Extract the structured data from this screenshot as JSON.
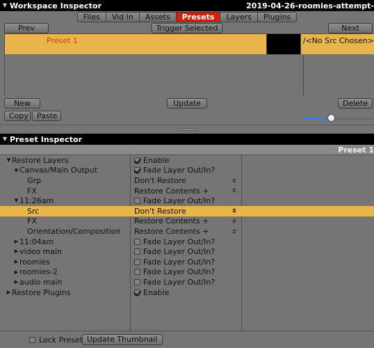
{
  "workspace_panel": {
    "title": "Workspace Inspector",
    "file_title": "2019-04-26-roomies-attempt-",
    "twisty": "▼",
    "tabs": [
      {
        "label": "Files",
        "active": false
      },
      {
        "label": "Vid In",
        "active": false
      },
      {
        "label": "Assets",
        "active": false
      },
      {
        "label": "Presets",
        "active": true
      },
      {
        "label": "Layers",
        "active": false
      },
      {
        "label": "Plugins",
        "active": false
      }
    ],
    "toolbar": {
      "prev_label": "Prev",
      "trigger_label": "Trigger Selected",
      "next_label": "Next"
    },
    "preset_rows": [
      {
        "name": "Preset 1",
        "src": "/<No Src Chosen>",
        "selected": true
      }
    ],
    "footer": {
      "new_label": "New",
      "update_label": "Update",
      "delete_label": "Delete",
      "copy_label": "Copy",
      "paste_label": "Paste",
      "slider_value": 38,
      "slider_min": 0,
      "slider_max": 100,
      "slider_fill_color": "#3b7ddd"
    }
  },
  "inspector_panel": {
    "title": "Preset Inspector",
    "twisty": "▼",
    "subbar_label": "Preset 1",
    "rows": [
      {
        "indent": 0,
        "twisty": "▼",
        "name": "Restore Layers",
        "control": "checkbox",
        "value": "Enable",
        "checked": true,
        "selected": false
      },
      {
        "indent": 1,
        "twisty": "▼",
        "name": "Canvas/Main Output",
        "control": "checkbox",
        "value": "Fade Layer Out/In?",
        "checked": true,
        "selected": false
      },
      {
        "indent": 2,
        "twisty": "",
        "name": "Grp",
        "control": "select",
        "value": "Don't Restore",
        "checked": false,
        "selected": false
      },
      {
        "indent": 2,
        "twisty": "",
        "name": "FX",
        "control": "select",
        "value": "Restore Contents +",
        "checked": false,
        "selected": false
      },
      {
        "indent": 1,
        "twisty": "▼",
        "name": "11:26am",
        "control": "checkbox",
        "value": "Fade Layer Out/In?",
        "checked": false,
        "selected": false
      },
      {
        "indent": 2,
        "twisty": "",
        "name": "Src",
        "control": "select",
        "value": "Don't Restore",
        "checked": false,
        "selected": true
      },
      {
        "indent": 2,
        "twisty": "",
        "name": "FX",
        "control": "select",
        "value": "Restore Contents +",
        "checked": false,
        "selected": false
      },
      {
        "indent": 2,
        "twisty": "",
        "name": "Orientation/Composition",
        "control": "select",
        "value": "Restore Contents +",
        "checked": false,
        "selected": false
      },
      {
        "indent": 1,
        "twisty": "▶",
        "name": "11:04am",
        "control": "checkbox",
        "value": "Fade Layer Out/In?",
        "checked": false,
        "selected": false
      },
      {
        "indent": 1,
        "twisty": "▶",
        "name": "video main",
        "control": "checkbox",
        "value": "Fade Layer Out/In?",
        "checked": false,
        "selected": false
      },
      {
        "indent": 1,
        "twisty": "▶",
        "name": "roomies",
        "control": "checkbox",
        "value": "Fade Layer Out/In?",
        "checked": false,
        "selected": false
      },
      {
        "indent": 1,
        "twisty": "▶",
        "name": "roomies-2",
        "control": "checkbox",
        "value": "Fade Layer Out/In?",
        "checked": false,
        "selected": false
      },
      {
        "indent": 1,
        "twisty": "▶",
        "name": "audio main",
        "control": "checkbox",
        "value": "Fade Layer Out/In?",
        "checked": false,
        "selected": false
      },
      {
        "indent": 0,
        "twisty": "▶",
        "name": "Restore Plugins",
        "control": "checkbox",
        "value": "Enable",
        "checked": true,
        "selected": false
      }
    ],
    "footer": {
      "lock_label": "Lock Preset",
      "lock_checked": false,
      "thumbnail_label": "Update Thumbnail"
    }
  },
  "theme": {
    "panel_bg": "#757575",
    "highlight": "#e8b54a",
    "accent_red": "#d81e05",
    "preset_name_color": "#d33a1b",
    "titlebar_bg": "#000000"
  }
}
